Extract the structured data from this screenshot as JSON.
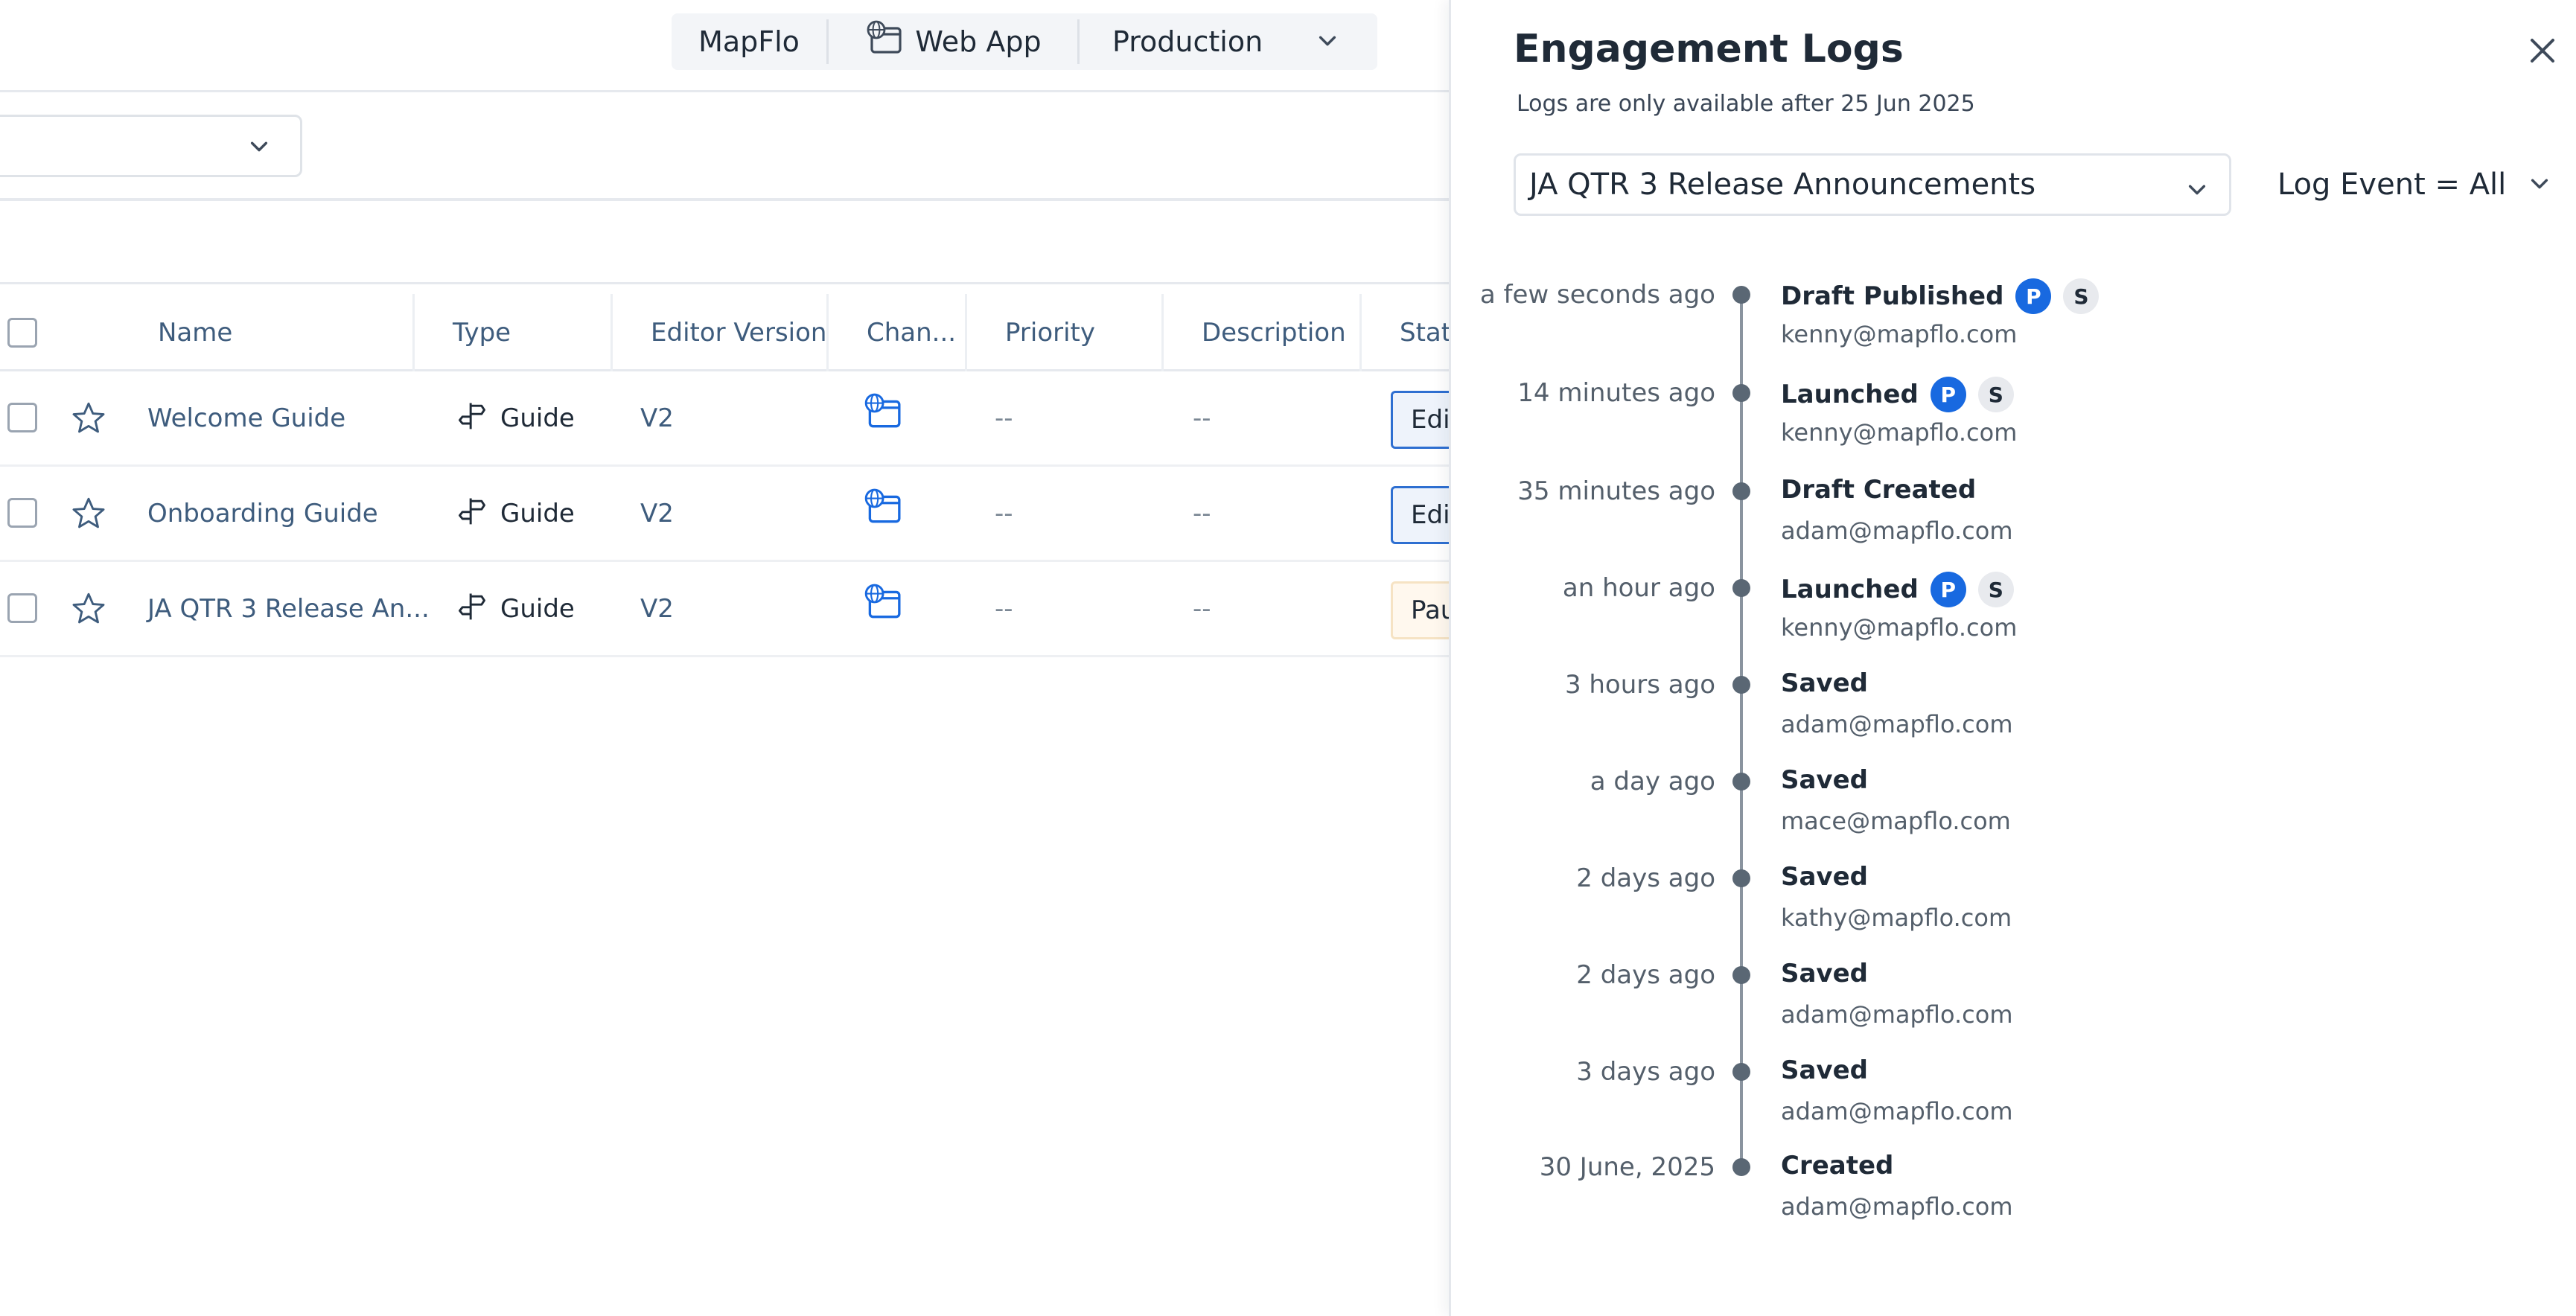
{
  "topbar": {
    "app_name": "MapFlo",
    "platform": "Web App",
    "environment": "Production"
  },
  "table": {
    "columns": [
      "Name",
      "Type",
      "Editor Version",
      "Chan...",
      "Priority",
      "Description",
      "Statu"
    ],
    "rows": [
      {
        "name": "Welcome Guide",
        "type": "Guide",
        "editor_version": "V2",
        "priority": "--",
        "description": "--",
        "status": "Edit"
      },
      {
        "name": "Onboarding Guide",
        "type": "Guide",
        "editor_version": "V2",
        "priority": "--",
        "description": "--",
        "status": "Edit"
      },
      {
        "name": "JA QTR 3 Release An...",
        "type": "Guide",
        "editor_version": "V2",
        "priority": "--",
        "description": "--",
        "status": "Pau"
      }
    ]
  },
  "drawer": {
    "title": "Engagement Logs",
    "subtitle": "Logs are only available after 25 Jun 2025",
    "selected_guide": "JA QTR 3 Release Announcements",
    "log_filter": "Log Event = All",
    "badge_p": "P",
    "badge_s": "S",
    "logs": [
      {
        "time": "a few seconds ago",
        "event": "Draft Published",
        "user": "kenny@mapflo.com",
        "badges": true
      },
      {
        "time": "14 minutes ago",
        "event": "Launched",
        "user": "kenny@mapflo.com",
        "badges": true
      },
      {
        "time": "35 minutes ago",
        "event": "Draft Created",
        "user": "adam@mapflo.com",
        "badges": false
      },
      {
        "time": "an hour ago",
        "event": "Launched",
        "user": "kenny@mapflo.com",
        "badges": true
      },
      {
        "time": "3 hours ago",
        "event": "Saved",
        "user": "adam@mapflo.com",
        "badges": false
      },
      {
        "time": "a day ago",
        "event": "Saved",
        "user": "mace@mapflo.com",
        "badges": false
      },
      {
        "time": "2 days ago",
        "event": "Saved",
        "user": "kathy@mapflo.com",
        "badges": false
      },
      {
        "time": "2 days ago",
        "event": "Saved",
        "user": "adam@mapflo.com",
        "badges": false
      },
      {
        "time": "3 days ago",
        "event": "Saved",
        "user": "adam@mapflo.com",
        "badges": false
      },
      {
        "time": "30 June, 2025",
        "event": "Created",
        "user": "adam@mapflo.com",
        "badges": false
      }
    ]
  },
  "colors": {
    "accent": "#1869e0",
    "link_text": "#3e5c7d",
    "timeline": "#5a6774"
  }
}
